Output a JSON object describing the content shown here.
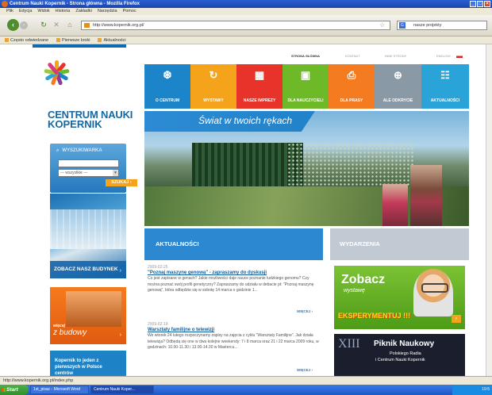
{
  "window": {
    "title": "Centrum Nauki Kopernik - Strona główna - Mozilla Firefox"
  },
  "menu": [
    "Plik",
    "Edycja",
    "Widok",
    "Historia",
    "Zakładki",
    "Narzędzia",
    "Pomoc"
  ],
  "nav": {
    "url": "http://www.kopernik.org.pl/",
    "search_value": "nasze projekty",
    "search_engine": "G"
  },
  "bookmarks": [
    "Często odwiedzane",
    "Pierwsze kroki",
    "Aktualności"
  ],
  "page": {
    "brand_line1": "CENTRUM NAUKI",
    "brand_line2": "KOPERNIK",
    "top_links": [
      "STRONA GŁÓWNA",
      "KONTAKT",
      "INNE STRONY",
      "ENGLISH"
    ],
    "tabs": [
      {
        "label": "O CENTRUM",
        "icon": "❆",
        "color": "#1c84c9"
      },
      {
        "label": "WYSTAWY",
        "icon": "↻",
        "color": "#f5a31a"
      },
      {
        "label": "NASZE IMPREZY",
        "icon": "▦",
        "color": "#e8332b"
      },
      {
        "label": "DLA NAUCZYCIELI",
        "icon": "▣",
        "color": "#6eb928"
      },
      {
        "label": "DLA PRASY",
        "icon": "⎙",
        "color": "#f47b20"
      },
      {
        "label": "ALE ODKRYCIE",
        "icon": "⊕",
        "color": "#8999a6"
      },
      {
        "label": "AKTUALNOŚCI",
        "icon": "☷",
        "color": "#2aa3d9"
      }
    ],
    "hero_slogan": "Świat w twoich rękach",
    "search": {
      "label": "WYSZUKIWARKA",
      "select": "--- wszystkie ---",
      "button": "SZUKAJ"
    },
    "sidebar": {
      "building": "ZOBACZ NASZ BUDYNEK",
      "budowy_small": "więcej",
      "budowy": "z budowy",
      "kopernik": "Kopernik to jeden z pierwszych w Polsce centrów"
    },
    "news_head": "AKTUALNOŚCI",
    "news": [
      {
        "date": "2009-02-25",
        "title": "\"Poznaj maszynę genową\" - zapraszamy do dyskusji",
        "body": "Co jest zapisane w genach? Jakie możliwości daje nauce poznanie ludzkiego genomu? Czy można poznać swój profil genetyczny? Zapraszamy do udziału w debacie pt: \"Poznaj maszynę genową\", która odbędzie się w sobotę 14 marca o godzinie 1...",
        "more": "WIĘCEJ"
      },
      {
        "date": "2009-02-19",
        "title": "Warsztaty familijne o telewizji",
        "body": "We wtorek 24 lutego rozpoczynamy zapisy na zajęcia z cyklu \"Warsztaty Familijne\". Jak działa telewizja? Odbędą się one w dwa kolejne weekendy: 7 i 8 marca oraz 21 i 22 marca 2009 roku, w godzinach: 10.00-11.30 i 13.00-14.30 w Mastercu...",
        "more": "WIĘCEJ"
      }
    ],
    "events_head": "WYDARZENIA",
    "promo": {
      "l1": "Zobacz",
      "l2": "wystawę",
      "l3": "EKSPERYMENTUJ !!!"
    },
    "piknik": {
      "roman": "XIII",
      "l1": "Piknik Naukowy",
      "l2": "Polskiego Radia",
      "l3": "i Centrum Nauki Kopernik"
    }
  },
  "status": "http://www.kopernik.org.pl/index.php",
  "taskbar": {
    "start": "Start",
    "items": [
      "1st_pisac - Microsoft Word",
      "Centrum Nauki Koper..."
    ],
    "tray": "19:5"
  }
}
